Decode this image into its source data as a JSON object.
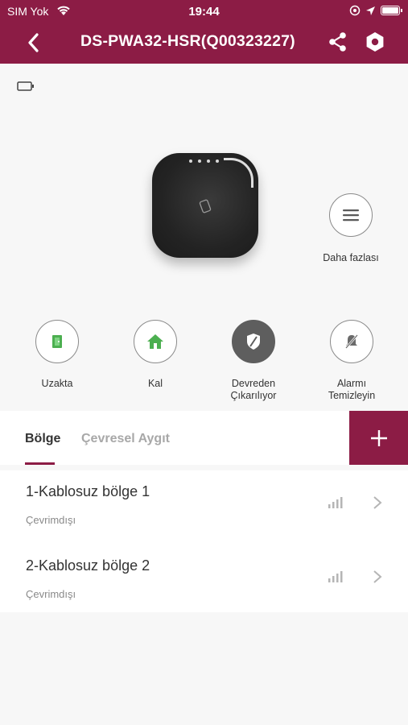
{
  "status_bar": {
    "carrier": "SIM Yok",
    "time": "19:44"
  },
  "header": {
    "title": "DS-PWA32-HSR(Q00323227)"
  },
  "more": {
    "label": "Daha fazlası"
  },
  "modes": [
    {
      "label": "Uzakta",
      "icon": "away-door-icon",
      "active": false
    },
    {
      "label": "Kal",
      "icon": "home-icon",
      "active": false
    },
    {
      "label": "Devreden Çıkarılıyor",
      "icon": "shield-disarm-icon",
      "active": true
    },
    {
      "label": "Alarmı Temizleyin",
      "icon": "bell-off-icon",
      "active": false
    }
  ],
  "tabs": {
    "zone": "Bölge",
    "peripheral": "Çevresel Aygıt"
  },
  "zones": [
    {
      "name": "1-Kablosuz bölge 1",
      "status": "Çevrimdışı"
    },
    {
      "name": "2-Kablosuz bölge 2",
      "status": "Çevrimdışı"
    }
  ],
  "colors": {
    "brand": "#8c1c45",
    "active_mode": "#5e5e5e",
    "green_icon": "#4caf50"
  }
}
